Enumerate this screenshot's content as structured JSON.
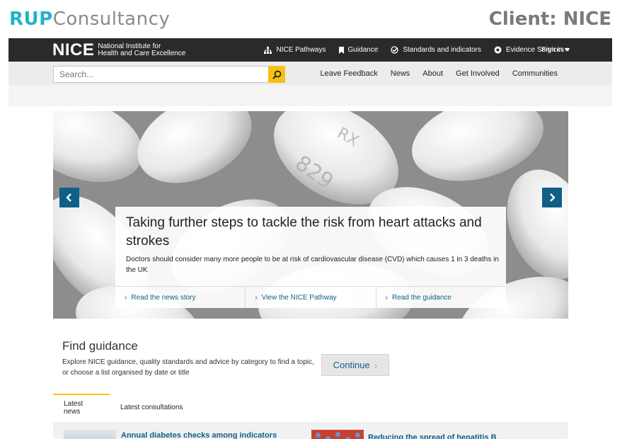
{
  "brand": {
    "left_bold": "RUP",
    "left_rest": "Consultancy",
    "client": "Client: NICE"
  },
  "site": {
    "logo_text": "NICE",
    "logo_sub_line1": "National Institute for",
    "logo_sub_line2": "Health and Care Excellence"
  },
  "topnav": {
    "items": [
      {
        "label": "NICE Pathways",
        "icon": "pathways-icon"
      },
      {
        "label": "Guidance",
        "icon": "bookmark-icon"
      },
      {
        "label": "Standards and indicators",
        "icon": "check-circle-icon"
      },
      {
        "label": "Evidence Services ▾",
        "icon": "circle-dot-icon"
      }
    ],
    "signin": "Sign in ▾"
  },
  "search": {
    "placeholder": "Search..."
  },
  "secnav": [
    "Leave Feedback",
    "News",
    "About",
    "Get Involved",
    "Communities"
  ],
  "hero": {
    "headline": "Taking further steps to tackle the risk from heart attacks and strokes",
    "summary": "Doctors should consider many more people to be at risk of cardiovascular disease (CVD) which causes 1 in 3 deaths in the UK",
    "links": [
      "Read the news story",
      "View the NICE Pathway",
      "Read the guidance"
    ],
    "pill_text_1": "829",
    "pill_text_2": "RX"
  },
  "find_guidance": {
    "title": "Find guidance",
    "description": "Explore NICE guidance, quality standards and advice by category to find a topic, or choose a list organised by date or title",
    "button": "Continue"
  },
  "tabs": [
    "Latest news",
    "Latest consultations"
  ],
  "news": [
    "Annual diabetes checks among indicators",
    "Reducing the spread of hepatitis B"
  ],
  "colors": {
    "accent": "#f4c20f",
    "link": "#0f5f86",
    "topbar": "#2a2a2a",
    "brand_cyan": "#22b3c8"
  }
}
